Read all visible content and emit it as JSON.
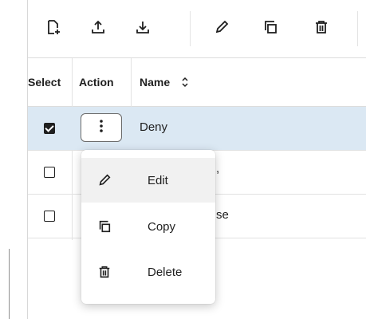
{
  "toolbar": {
    "buttons": [
      {
        "icon": "new-document-icon"
      },
      {
        "icon": "upload-icon"
      },
      {
        "icon": "download-icon"
      },
      {
        "icon": "pencil-icon"
      },
      {
        "icon": "copy-icon"
      },
      {
        "icon": "trash-icon"
      }
    ]
  },
  "table": {
    "headers": {
      "select": "Select",
      "action": "Action",
      "name": "Name"
    },
    "rows": [
      {
        "name": "Deny",
        "selected": true
      },
      {
        "name": "",
        "selected": false,
        "partial_text": ","
      },
      {
        "name": "",
        "selected": false,
        "partial_text": "se"
      }
    ]
  },
  "menu": {
    "items": [
      {
        "label": "Edit",
        "icon": "pencil-icon"
      },
      {
        "label": "Copy",
        "icon": "copy-icon"
      },
      {
        "label": "Delete",
        "icon": "trash-icon"
      }
    ]
  },
  "colors": {
    "selected_row": "#dbe8f3",
    "menu_hover": "#f1f1f1",
    "text": "#1f1f1f"
  }
}
